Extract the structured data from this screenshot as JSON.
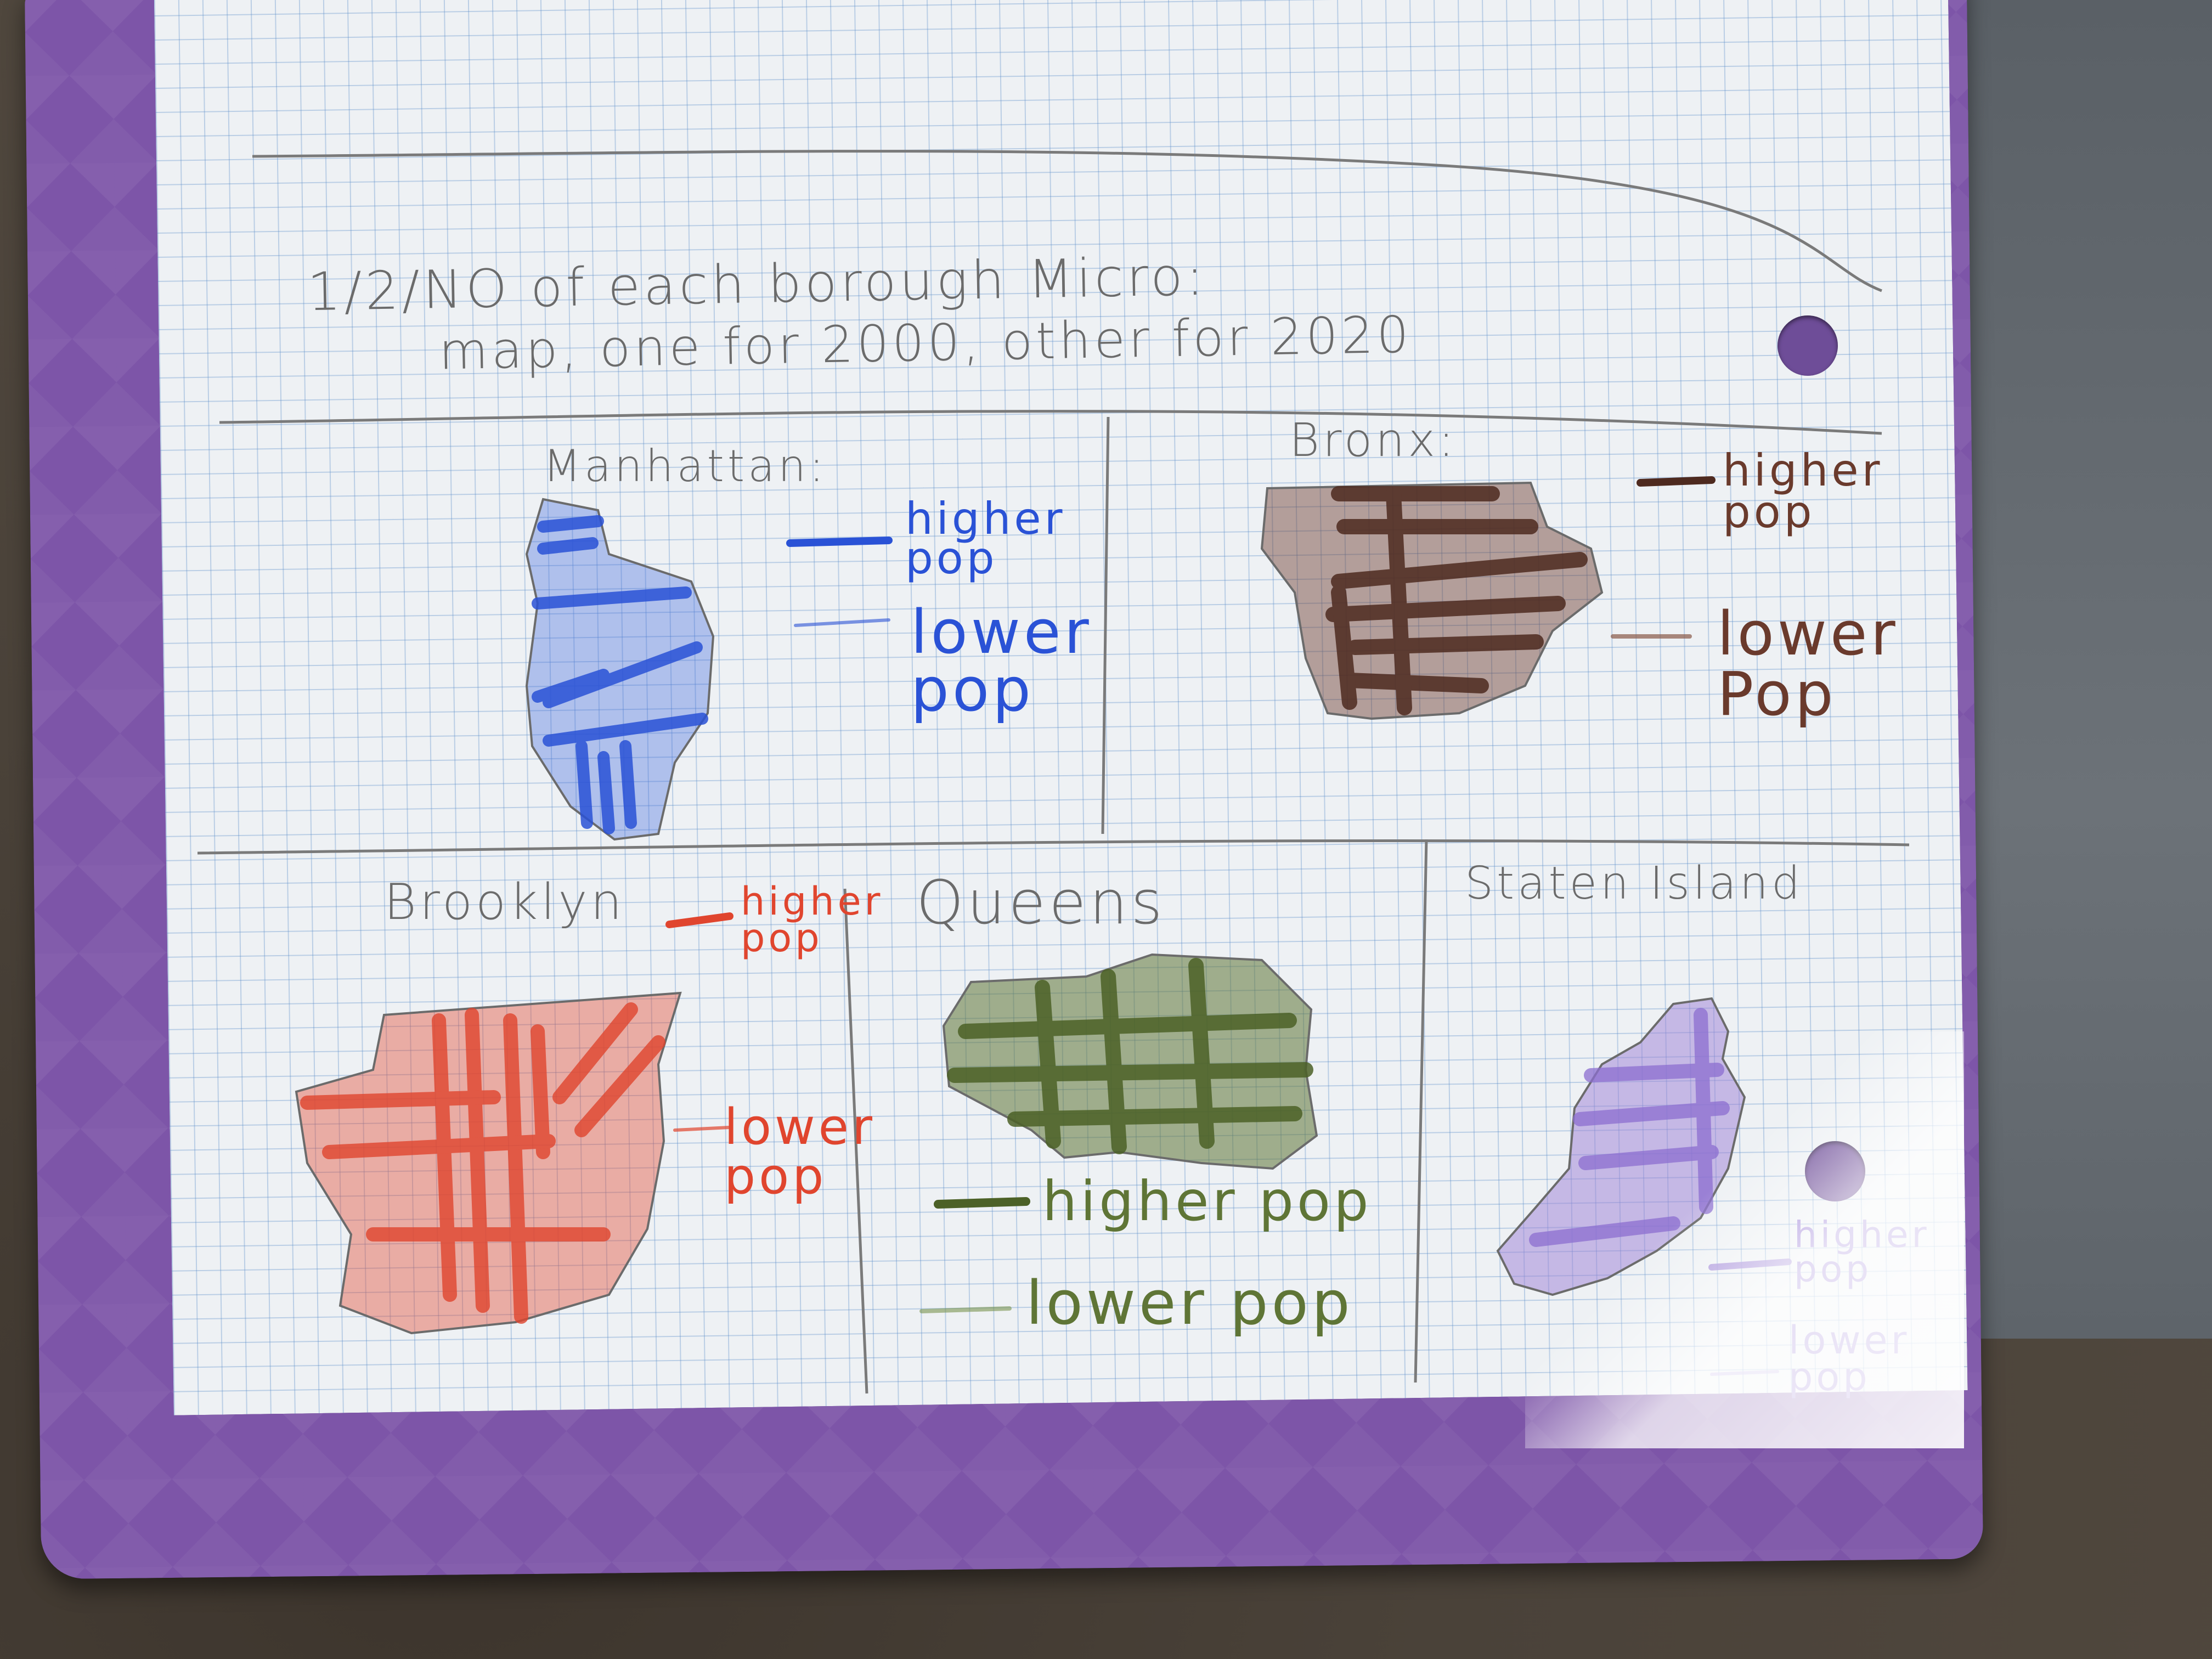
{
  "notes": {
    "header_line1": "1/2/NO of each borough Micro:",
    "header_line2": "map, one for 2000, other for 2020"
  },
  "boroughs": [
    {
      "name": "Manhattan:",
      "higher": "higher pop",
      "lower": "lower pop",
      "color": "#2a52d6"
    },
    {
      "name": "Bronx:",
      "higher": "higher pop",
      "lower": "lower Pop",
      "color": "#6a3a2c"
    },
    {
      "name": "Brooklyn",
      "higher": "higher pop",
      "lower": "lower pop",
      "color": "#e0452e"
    },
    {
      "name": "Queens",
      "higher": "higher pop",
      "lower": "lower pop",
      "color": "#5f7536"
    },
    {
      "name": "Staten Island",
      "higher": "higher pop",
      "lower": "lower pop",
      "color": "#9b7fd6"
    }
  ],
  "colors": {
    "folder": "#7d55a8",
    "paper": "#eef1f4",
    "grid": "#5a8cc8",
    "pencil": "#6b6b6b"
  }
}
